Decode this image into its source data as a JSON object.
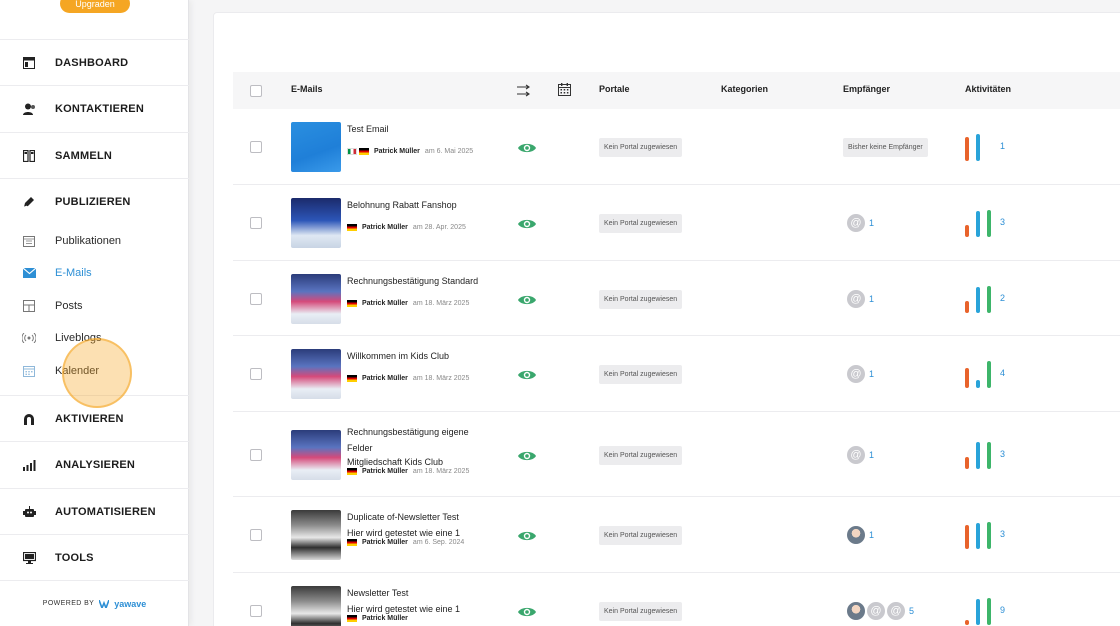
{
  "sidebar": {
    "upgrade_label": "Upgraden",
    "main_items": [
      {
        "label": "DASHBOARD",
        "icon": "dashboard-icon"
      },
      {
        "label": "KONTAKTIEREN",
        "icon": "contacts-icon"
      },
      {
        "label": "SAMMELN",
        "icon": "collect-icon"
      },
      {
        "label": "PUBLIZIEREN",
        "icon": "pen-icon"
      },
      {
        "label": "AKTIVIEREN",
        "icon": "magnet-icon"
      },
      {
        "label": "ANALYSIEREN",
        "icon": "analytics-icon"
      },
      {
        "label": "AUTOMATISIEREN",
        "icon": "robot-icon"
      },
      {
        "label": "TOOLS",
        "icon": "monitor-icon"
      }
    ],
    "sub_items": [
      {
        "label": "Publikationen",
        "icon": "publications-icon"
      },
      {
        "label": "E-Mails",
        "icon": "email-icon",
        "active": true
      },
      {
        "label": "Posts",
        "icon": "posts-icon"
      },
      {
        "label": "Liveblogs",
        "icon": "liveblog-icon"
      },
      {
        "label": "Kalender",
        "icon": "calendar-icon"
      }
    ],
    "powered_by": "POWERED BY",
    "brand": "yawave"
  },
  "table": {
    "headers": {
      "emails": "E-Mails",
      "portale": "Portale",
      "kategorien": "Kategorien",
      "empfaenger": "Empfänger",
      "aktivitaeten": "Aktivitäten"
    },
    "rows": [
      {
        "title": "Test Email",
        "subtitle": "",
        "flags": [
          "it",
          "de"
        ],
        "author": "Patrick Müller",
        "date": "am 6. Mai 2025",
        "portal": "Kein Portal zugewiesen",
        "recipients_none": "Bisher keine Empfänger",
        "avatars": [],
        "recipient_count": "",
        "activities": "1",
        "bars": [
          0.9,
          1.0,
          0.0
        ],
        "thumb": "blue"
      },
      {
        "title": "Belohnung Rabatt Fanshop",
        "subtitle": "",
        "flags": [
          "de"
        ],
        "author": "Patrick Müller",
        "date": "am 28. Apr. 2025",
        "portal": "Kein Portal zugewiesen",
        "recipients_none": "",
        "avatars": [
          "at"
        ],
        "recipient_count": "1",
        "activities": "3",
        "bars": [
          0.45,
          0.95,
          1.0
        ],
        "thumb": "hockey"
      },
      {
        "title": "Rechnungsbestätigung Standard",
        "subtitle": "",
        "flags": [
          "de"
        ],
        "author": "Patrick Müller",
        "date": "am 18. März 2025",
        "portal": "Kein Portal zugewiesen",
        "recipients_none": "",
        "avatars": [
          "at"
        ],
        "recipient_count": "1",
        "activities": "2",
        "bars": [
          0.45,
          0.95,
          1.0
        ],
        "thumb": "kids"
      },
      {
        "title": "Willkommen im Kids Club",
        "subtitle": "",
        "flags": [
          "de"
        ],
        "author": "Patrick Müller",
        "date": "am 18. März 2025",
        "portal": "Kein Portal zugewiesen",
        "recipients_none": "",
        "avatars": [
          "at"
        ],
        "recipient_count": "1",
        "activities": "4",
        "bars": [
          0.75,
          0.3,
          1.0
        ],
        "thumb": "kids"
      },
      {
        "title": "Rechnungsbestätigung eigene",
        "title2": "Felder",
        "subtitle": "Mitgliedschaft Kids Club",
        "flags": [
          "de"
        ],
        "author": "Patrick Müller",
        "date": "am 18. März 2025",
        "portal": "Kein Portal zugewiesen",
        "recipients_none": "",
        "avatars": [
          "at"
        ],
        "recipient_count": "1",
        "activities": "3",
        "bars": [
          0.45,
          1.0,
          1.0
        ],
        "thumb": "kids"
      },
      {
        "title": "Duplicate of-Newsletter Test",
        "subtitle": "Hier wird getestet wie eine 1",
        "flags": [
          "de"
        ],
        "author": "Patrick Müller",
        "date": "am 6. Sep. 2024",
        "portal": "Kein Portal zugewiesen",
        "recipients_none": "",
        "avatars": [
          "photo"
        ],
        "recipient_count": "1",
        "activities": "3",
        "bars": [
          0.9,
          0.95,
          1.0
        ],
        "thumb": "game"
      },
      {
        "title": "Newsletter Test",
        "subtitle": "Hier wird getestet wie eine 1",
        "flags": [
          "de"
        ],
        "author": "Patrick Müller",
        "date": "",
        "portal": "Kein Portal zugewiesen",
        "recipients_none": "",
        "avatars": [
          "photo",
          "at",
          "at"
        ],
        "recipient_count": "5",
        "activities": "9",
        "bars": [
          0.2,
          0.95,
          1.0
        ],
        "thumb": "game"
      }
    ]
  },
  "colors": {
    "accent": "#2d8fd5",
    "orange": "#e8632b",
    "blue": "#29a3d9",
    "green": "#3db56a",
    "eye": "#3aa76d",
    "upgrade": "#f5a623"
  }
}
